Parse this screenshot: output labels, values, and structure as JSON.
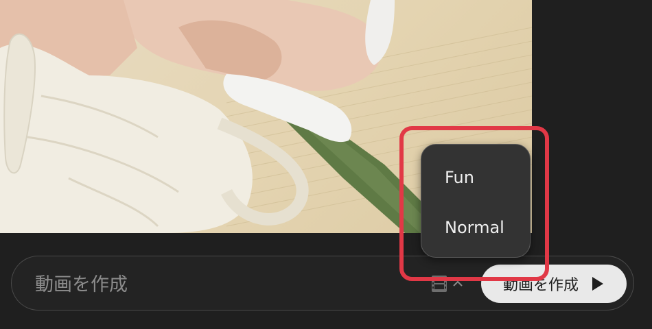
{
  "composer": {
    "placeholder": "動画を作成",
    "create_label": "動画を作成",
    "style_icon": "film-icon",
    "style_toggle_icon": "chevron-up-icon",
    "create_icon": "play-icon"
  },
  "style_menu": {
    "items": [
      {
        "label": "Fun"
      },
      {
        "label": "Normal"
      }
    ]
  },
  "colors": {
    "background": "#1f1f1f",
    "highlight": "#e13846",
    "menu": "#333333",
    "button": "#e9e9e9"
  }
}
